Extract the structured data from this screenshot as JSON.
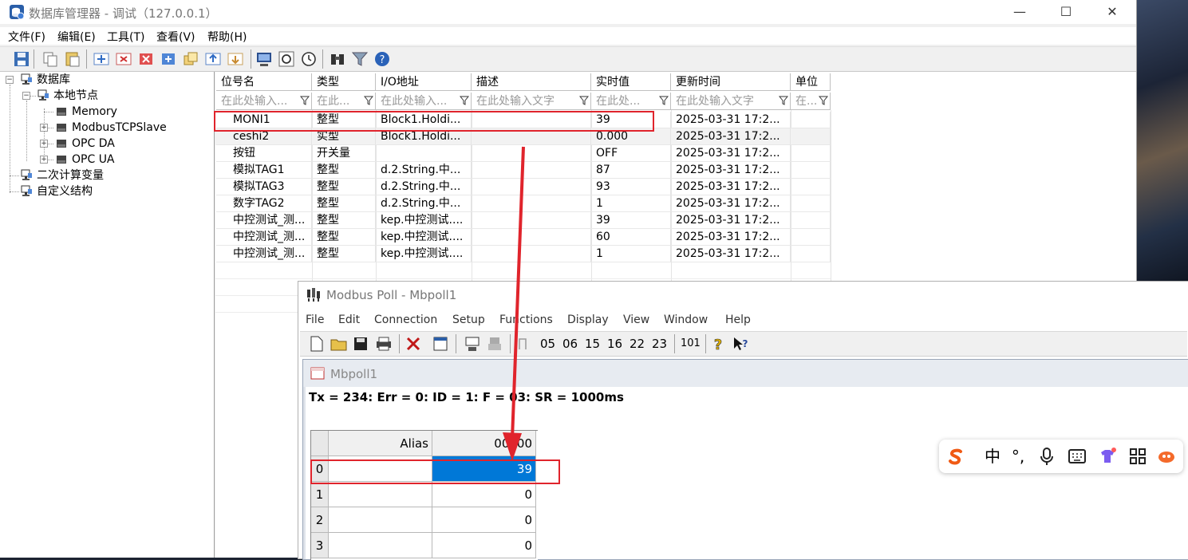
{
  "db_window": {
    "title": "数据库管理器 - 调试（127.0.0.1）",
    "controls": {
      "minimize": "—",
      "maximize": "☐",
      "close": "✕"
    },
    "menu": [
      "文件(F)",
      "编辑(E)",
      "工具(T)",
      "查看(V)",
      "帮助(H)"
    ],
    "toolbar_icons": [
      "save-icon",
      "copy-icon",
      "paste-icon",
      "add-row-icon",
      "delete-row-icon",
      "delete-icon",
      "add-node-icon",
      "clone-icon",
      "import-icon",
      "export-icon",
      "monitor-icon",
      "refresh-icon",
      "clock-icon",
      "binoculars-icon",
      "filter-icon",
      "help-icon"
    ],
    "tree": {
      "root": "数据库",
      "local_node": "本地节点",
      "children": [
        "Memory",
        "ModbusTCPSlave",
        "OPC DA",
        "OPC UA"
      ],
      "secondary": "二次计算变量",
      "custom": "自定义结构"
    },
    "table": {
      "columns": [
        "位号名",
        "类型",
        "I/O地址",
        "描述",
        "实时值",
        "更新时间",
        "单位"
      ],
      "filters": [
        "在此处输入...",
        "在此...",
        "在此处输入...",
        "在此处输入文字",
        "在此处...",
        "在此处输入文字",
        "在..."
      ],
      "rows": [
        [
          "MONI1",
          "整型",
          "Block1.Holdi...",
          "",
          "39",
          "2025-03-31 17:2...",
          ""
        ],
        [
          "ceshi2",
          "实型",
          "Block1.Holdi...",
          "",
          "0.000",
          "2025-03-31 17:2...",
          ""
        ],
        [
          "按钮",
          "开关量",
          "",
          "",
          "OFF",
          "2025-03-31 17:2...",
          ""
        ],
        [
          "模拟TAG1",
          "整型",
          "d.2.String.中...",
          "",
          "87",
          "2025-03-31 17:2...",
          ""
        ],
        [
          "模拟TAG3",
          "整型",
          "d.2.String.中...",
          "",
          "93",
          "2025-03-31 17:2...",
          ""
        ],
        [
          "数字TAG2",
          "整型",
          "d.2.String.中...",
          "",
          "1",
          "2025-03-31 17:2...",
          ""
        ],
        [
          "中控测试_测...",
          "整型",
          "kep.中控测试....",
          "",
          "39",
          "2025-03-31 17:2...",
          ""
        ],
        [
          "中控测试_测...",
          "整型",
          "kep.中控测试....",
          "",
          "60",
          "2025-03-31 17:2...",
          ""
        ],
        [
          "中控测试_测...",
          "整型",
          "kep.中控测试....",
          "",
          "1",
          "2025-03-31 17:2...",
          ""
        ]
      ]
    }
  },
  "modbus_window": {
    "title": "Modbus Poll - Mbpoll1",
    "menu": [
      "File",
      "Edit",
      "Connection",
      "Setup",
      "Functions",
      "Display",
      "View",
      "Window",
      "Help"
    ],
    "toolbar_codes": [
      "05",
      "06",
      "15",
      "16",
      "22",
      "23",
      "101"
    ],
    "child_title": "Mbpoll1",
    "status_line": "Tx = 234: Err = 0: ID = 1: F = 03: SR = 1000ms",
    "grid": {
      "alias_header": "Alias",
      "address_header": "00000",
      "rows": [
        {
          "index": "0",
          "value": "39"
        },
        {
          "index": "1",
          "value": "0"
        },
        {
          "index": "2",
          "value": "0"
        },
        {
          "index": "3",
          "value": "0"
        }
      ]
    }
  },
  "ime_toolbar": {
    "mode": "中",
    "punct": "°,"
  },
  "colors": {
    "highlight": "#e0242c",
    "selected_cell": "#0078d7",
    "arrow": "#e0242c"
  }
}
